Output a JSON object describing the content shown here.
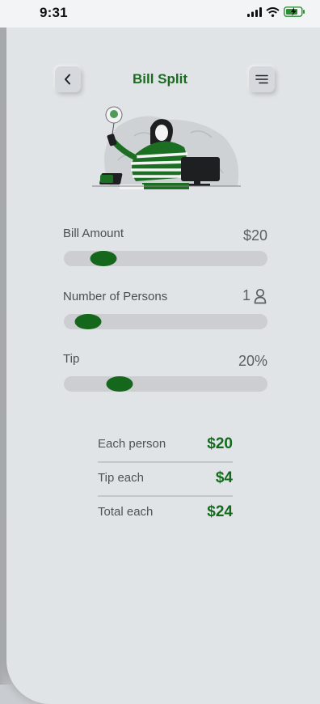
{
  "status_bar": {
    "time": "9:31"
  },
  "header": {
    "title": "Bill Split",
    "back_icon": "chevron-left-icon",
    "menu_icon": "menu-icon"
  },
  "controls": [
    {
      "label": "Bill Amount",
      "value": "$20",
      "slider_fraction": 0.15
    },
    {
      "label": "Number of Persons",
      "value": "1",
      "value_icon": "person-icon",
      "slider_fraction": 0.06
    },
    {
      "label": "Tip",
      "value": "20%",
      "slider_fraction": 0.24
    }
  ],
  "summary": [
    {
      "label": "Each person",
      "value": "$20"
    },
    {
      "label": "Tip each",
      "value": "$4"
    },
    {
      "label": "Total each",
      "value": "$24"
    }
  ],
  "colors": {
    "accent": "#14671b",
    "background": "#e1e4e7",
    "track": "#ccced2"
  }
}
